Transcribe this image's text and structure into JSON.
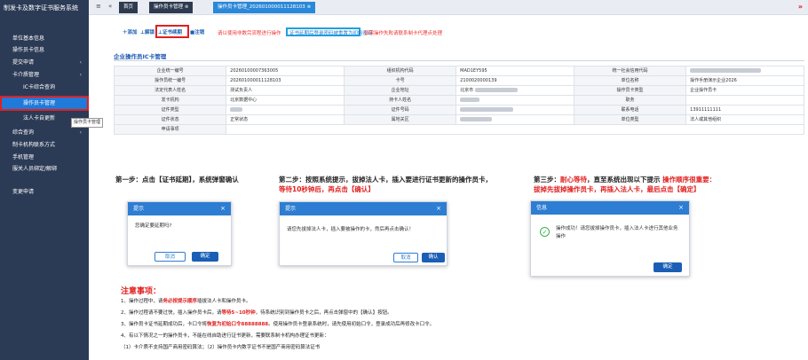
{
  "sidebar": {
    "header": "制发卡及数字证书服务系统",
    "items": [
      {
        "label": "单位基本信息",
        "arrow": ""
      },
      {
        "label": "操作员卡信息",
        "arrow": ""
      },
      {
        "label": "提交申请",
        "arrow": "‹"
      },
      {
        "label": "卡介质管理",
        "arrow": "‹"
      },
      {
        "label": "IC卡综合查询",
        "arrow": ""
      },
      {
        "label": "操作员卡管理",
        "arrow": ""
      },
      {
        "label": "法人卡自更新",
        "arrow": ""
      },
      {
        "label": "综合查询",
        "arrow": "‹"
      },
      {
        "label": "制卡机构联系方式",
        "arrow": ""
      },
      {
        "label": "手机管理",
        "arrow": ""
      },
      {
        "label": "服关人员绑定/解绑",
        "arrow": ""
      },
      {
        "label": "变更申请",
        "arrow": ""
      }
    ],
    "tooltip": "操作员卡管理"
  },
  "topbar": {
    "tabs": [
      "首页",
      "操作员卡管理",
      "操作员卡管理_202601000011128103"
    ],
    "close": "⊗"
  },
  "toolbar": {
    "buttons": [
      "添加",
      "解锁",
      "证书续期",
      "注销"
    ],
    "notice_red": "请以使用非数完流程进行操作",
    "notice_blue": "证书延期后登录密码被重置为初始密码",
    "notice_red2": "如需操作失败请联系制卡代理点处理"
  },
  "section": {
    "title": "企业操作员IC卡管理"
  },
  "table": {
    "rows": [
      [
        "企业统一编号",
        "20260100007363005",
        "组织机构代码",
        "MAD1EY595",
        "统一社会信用代码",
        ""
      ],
      [
        "操作员统一编号",
        "202601000011128103",
        "卡号",
        "2100020000139",
        "单位名称",
        "操作手册演示企业2026"
      ],
      [
        "法定代表人姓名",
        "测试负责人",
        "企业地址",
        "北京市",
        "操作员卡类型",
        "企业操作员卡"
      ],
      [
        "发卡机构",
        "北京数据中心",
        "持卡人姓名",
        "",
        "职务",
        ""
      ],
      [
        "证件类型",
        "",
        "证件号码",
        "",
        "联系电话",
        "13911111111"
      ],
      [
        "证件状态",
        "正常状态",
        "属地关区",
        "",
        "单位类型",
        "法人或其他组织"
      ],
      [
        "申请事项",
        "",
        "",
        "",
        "",
        ""
      ]
    ]
  },
  "steps": {
    "s1": "第一步：点击【证书延期】，系统弹窗确认",
    "s2a": "第二步：按照系统提示，拔掉法人卡，插入要进行证书更新的操作员卡，",
    "s2b": "等待10秒钟后，再点击【确认】",
    "s3a": "第三步：",
    "s3b": "耐心等待",
    "s3c": "，直至系统出现以下提示",
    "s3d": "操作顺序很重要：",
    "s3e": "拔掉先拔掉操作员卡，再插入法人卡，最后点击【确定】"
  },
  "dialogs": {
    "d1": {
      "title": "提示",
      "msg": "您确定要延期吗?",
      "cancel": "取消",
      "ok": "确定"
    },
    "d2": {
      "title": "提示",
      "msg": "请您先拔掉法人卡，插入要被操作的卡，然后再点击确认！",
      "cancel": "取消",
      "ok": "确认"
    },
    "d3": {
      "title": "信息",
      "msg": "操作成功！请您拔掉操作员卡，插入法人卡进行其他业务操作",
      "ok": "确定"
    },
    "close": "×"
  },
  "notes": {
    "title": "注意事项：",
    "n1a": "1、操作过程中，请",
    "n1b": "务必按提示顺序",
    "n1c": "插拔法人卡和操作员卡。",
    "n2a": "2、操作过程请不要过快，插入操作员卡后，请",
    "n2b": "等待5~10秒钟",
    "n2c": "，待系统识别到操作员卡之后，再点击弹窗中的【确认】按钮。",
    "n3a": "3、操作员卡证书延期成功后，卡口令将",
    "n3b": "恢复为初始口令88888888",
    "n3c": "。使用操作员卡登录系统时，请先使用初始口令，登录成功后再修改卡口令。",
    "n4": "4、有以下情况之一的操作员卡，不能在线自助进行证书更新，需要联系制卡机构办理证书更新：",
    "n5": "（1）卡介质不支持国产商用密码算法；（2）操作员卡内数字证书不是国产商用密码算法证书"
  }
}
